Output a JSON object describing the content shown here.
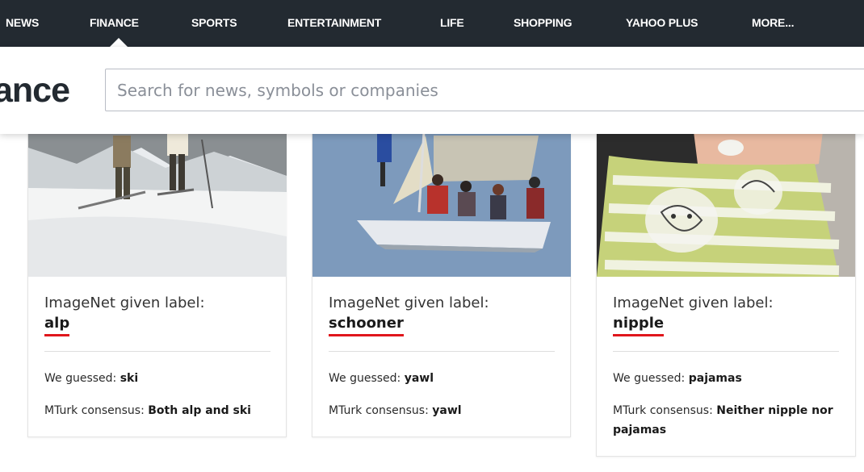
{
  "topnav": {
    "items": [
      "NEWS",
      "FINANCE",
      "SPORTS",
      "ENTERTAINMENT",
      "LIFE",
      "SHOPPING",
      "YAHOO PLUS",
      "MORE..."
    ],
    "active": "FINANCE"
  },
  "brand": {
    "text": "ance"
  },
  "search": {
    "placeholder": "Search for news, symbols or companies"
  },
  "cards": [
    {
      "given_prefix": "ImageNet given label:",
      "label": "alp",
      "guessed_prefix": "We guessed: ",
      "guessed": "ski",
      "consensus_prefix": "MTurk consensus: ",
      "consensus": "Both alp and ski",
      "image_icon": "skiers-photo"
    },
    {
      "given_prefix": "ImageNet given label:",
      "label": "schooner",
      "guessed_prefix": "We guessed: ",
      "guessed": "yawl",
      "consensus_prefix": "MTurk consensus: ",
      "consensus": "yawl",
      "image_icon": "sailboat-photo"
    },
    {
      "given_prefix": "ImageNet given label:",
      "label": "nipple",
      "guessed_prefix": "We guessed: ",
      "guessed": "pajamas",
      "consensus_prefix": "MTurk consensus: ",
      "consensus": "Neither nipple nor pajamas",
      "image_icon": "baby-photo"
    }
  ],
  "colors": {
    "nav_bg": "#232a31",
    "label_underline": "#e0161c"
  }
}
